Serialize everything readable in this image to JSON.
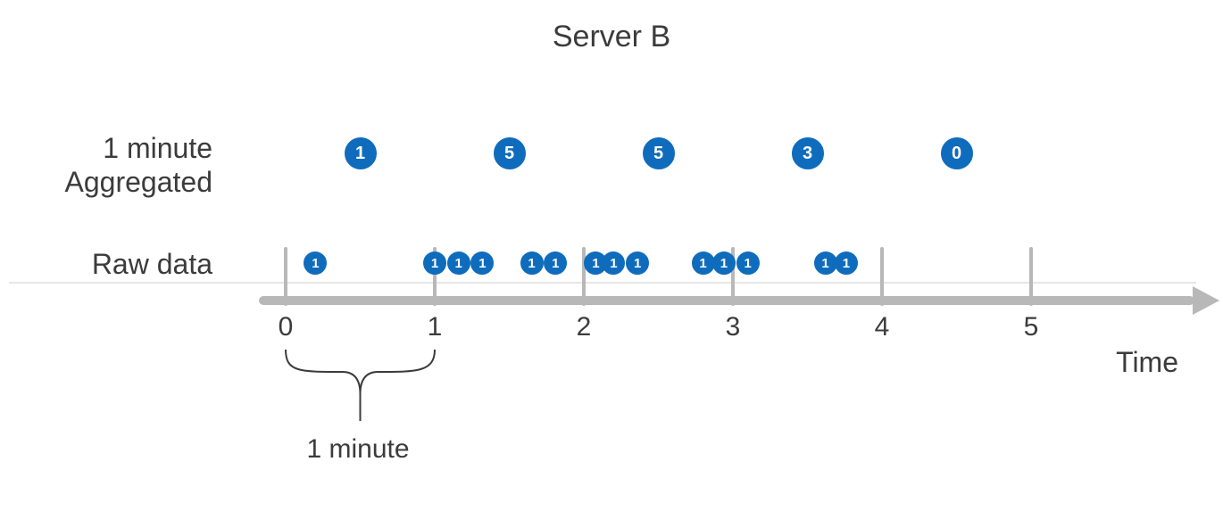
{
  "title": "Server B",
  "rows": {
    "aggregated": {
      "label_line1": "1 minute",
      "label_line2": "Aggregated"
    },
    "raw": {
      "label": "Raw data"
    }
  },
  "axis": {
    "label": "Time",
    "ticks": [
      "0",
      "1",
      "2",
      "3",
      "4",
      "5"
    ]
  },
  "interval_label": "1 minute",
  "colors": {
    "accent": "#0f6cbd",
    "axis": "#b8b8b8"
  },
  "chart_data": {
    "type": "scatter",
    "xlabel": "Time",
    "x_unit": "minutes",
    "x_range": [
      0,
      5
    ],
    "series": [
      {
        "name": "1 minute Aggregated",
        "points": [
          {
            "x": 0.5,
            "value": 1
          },
          {
            "x": 1.5,
            "value": 5
          },
          {
            "x": 2.5,
            "value": 5
          },
          {
            "x": 3.5,
            "value": 3
          },
          {
            "x": 4.5,
            "value": 0
          }
        ]
      },
      {
        "name": "Raw data",
        "points": [
          {
            "x": 0.2,
            "value": 1
          },
          {
            "x": 1.0,
            "value": 1
          },
          {
            "x": 1.16,
            "value": 1
          },
          {
            "x": 1.32,
            "value": 1
          },
          {
            "x": 1.65,
            "value": 1
          },
          {
            "x": 1.81,
            "value": 1
          },
          {
            "x": 2.08,
            "value": 1
          },
          {
            "x": 2.2,
            "value": 1
          },
          {
            "x": 2.36,
            "value": 1
          },
          {
            "x": 2.8,
            "value": 1
          },
          {
            "x": 2.94,
            "value": 1
          },
          {
            "x": 3.1,
            "value": 1
          },
          {
            "x": 3.62,
            "value": 1
          },
          {
            "x": 3.76,
            "value": 1
          }
        ]
      }
    ],
    "interval_brace": {
      "from": 0,
      "to": 1,
      "label": "1 minute"
    }
  }
}
